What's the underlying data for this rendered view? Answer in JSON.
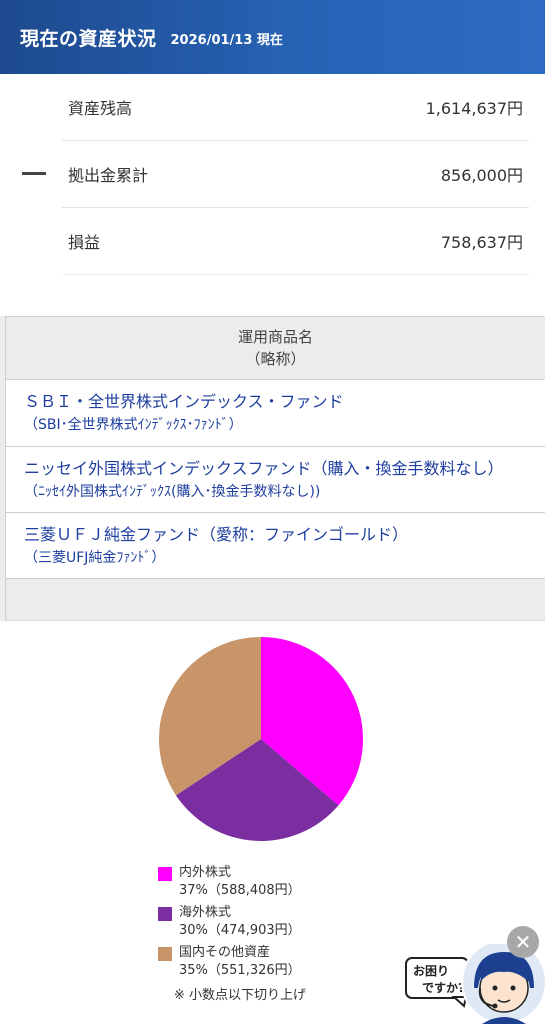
{
  "header": {
    "title": "現在の資産状況",
    "date": "2026/01/13 現在"
  },
  "summary": {
    "rows": [
      {
        "label": "資産残高",
        "value": "1,614,637円"
      },
      {
        "label": "拠出金累計",
        "value": "856,000円"
      },
      {
        "label": "損益",
        "value": "758,637円"
      }
    ]
  },
  "table": {
    "header_line1": "運用商品名",
    "header_line2": "（略称）",
    "products": [
      {
        "name": "ＳＢＩ・全世界株式インデックス・ファンド",
        "abbr": "（SBI･全世界株式ｲﾝﾃﾞｯｸｽ･ﾌｧﾝﾄﾞ）"
      },
      {
        "name": "ニッセイ外国株式インデックスファンド（購入・換金手数料なし）",
        "abbr": "（ﾆｯｾｲ外国株式ｲﾝﾃﾞｯｸｽ(購入･換金手数料なし))"
      },
      {
        "name": "三菱ＵＦＪ純金ファンド（愛称：ファインゴールド）",
        "abbr": "（三菱UFJ純金ﾌｧﾝﾄﾞ）"
      }
    ]
  },
  "chart_data": {
    "type": "pie",
    "slices": [
      {
        "name": "内外株式",
        "percent": 37,
        "amount": "588,408円",
        "color": "#ff00ff"
      },
      {
        "name": "海外株式",
        "percent": 30,
        "amount": "474,903円",
        "color": "#7b2ea0"
      },
      {
        "name": "国内その他資産",
        "percent": 35,
        "amount": "551,326円",
        "color": "#c8956a"
      }
    ],
    "labels": [
      "37%（588,408円）",
      "30%（474,903円）",
      "35%（551,326円）"
    ],
    "note": "※ 小数点以下切り上げ",
    "legend_position": "bottom-left"
  },
  "helper": {
    "bubble_text_1": "お困り",
    "bubble_text_2": "ですか?",
    "close_label": "✕"
  }
}
